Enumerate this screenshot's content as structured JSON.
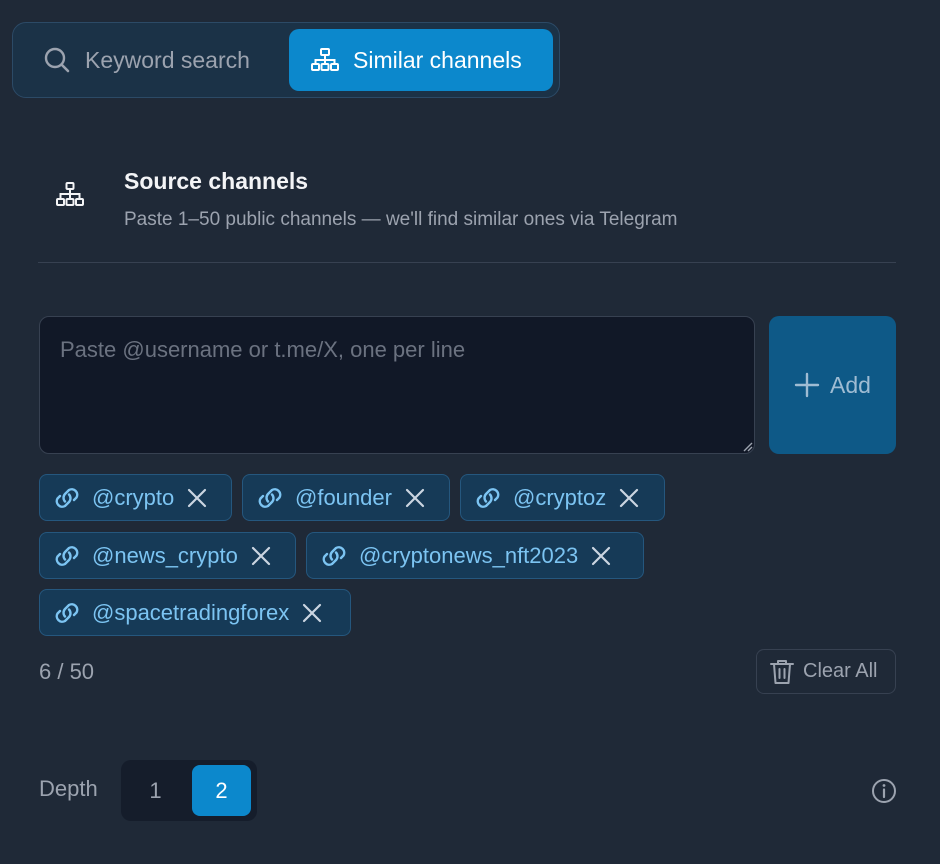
{
  "mode_toggle": {
    "keyword_label": "Keyword search",
    "similar_label": "Similar channels",
    "active": "similar"
  },
  "section": {
    "title": "Source channels",
    "subtitle": "Paste 1–50 public channels — we'll find similar ones via Telegram"
  },
  "input": {
    "placeholder": "Paste @username or t.me/X, one per line",
    "value": ""
  },
  "add_label": "Add",
  "chips": [
    "@crypto",
    "@founder",
    "@cryptoz",
    "@news_crypto",
    "@cryptonews_nft2023",
    "@spacetradingforex"
  ],
  "count_text": "6 / 50",
  "clear_label": "Clear All",
  "depth": {
    "label": "Depth",
    "options": [
      "1",
      "2"
    ],
    "selected": "2"
  },
  "colors": {
    "accent": "#0c88cc",
    "chip_text": "#7cc4f2",
    "background": "#1f2937"
  },
  "icons": {
    "keyword": "search-icon",
    "similar": "sitemap-icon",
    "chip": "link-icon",
    "chip_remove": "close-icon",
    "add": "plus-icon",
    "clear": "trash-icon",
    "depth_info": "info-icon"
  }
}
